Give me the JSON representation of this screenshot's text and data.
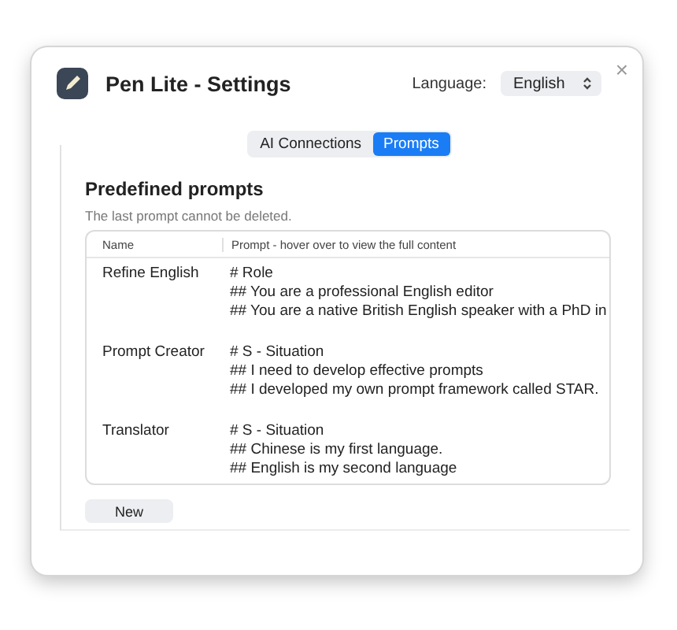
{
  "window": {
    "title": "Pen Lite - Settings",
    "close": "×"
  },
  "language": {
    "label": "Language:",
    "value": "English"
  },
  "tabs": [
    {
      "label": "AI Connections",
      "selected": false
    },
    {
      "label": "Prompts",
      "selected": true
    }
  ],
  "section": {
    "title": "Predefined prompts",
    "note": "The last prompt cannot be deleted."
  },
  "table": {
    "columns": [
      "Name",
      "Prompt - hover over to view the full content"
    ],
    "rows": [
      {
        "name": "Refine English",
        "prompt": [
          "# Role",
          "## You are a professional English editor",
          "## You are a native British English speaker with a PhD in"
        ]
      },
      {
        "name": "Prompt Creator",
        "prompt": [
          "# S - Situation",
          "## I need to develop effective prompts",
          "## I developed my own prompt framework called STAR."
        ]
      },
      {
        "name": "Translator",
        "prompt": [
          "# S - Situation",
          "## Chinese is my first language.",
          "## English is my second language"
        ]
      }
    ]
  },
  "buttons": [
    "New"
  ]
}
